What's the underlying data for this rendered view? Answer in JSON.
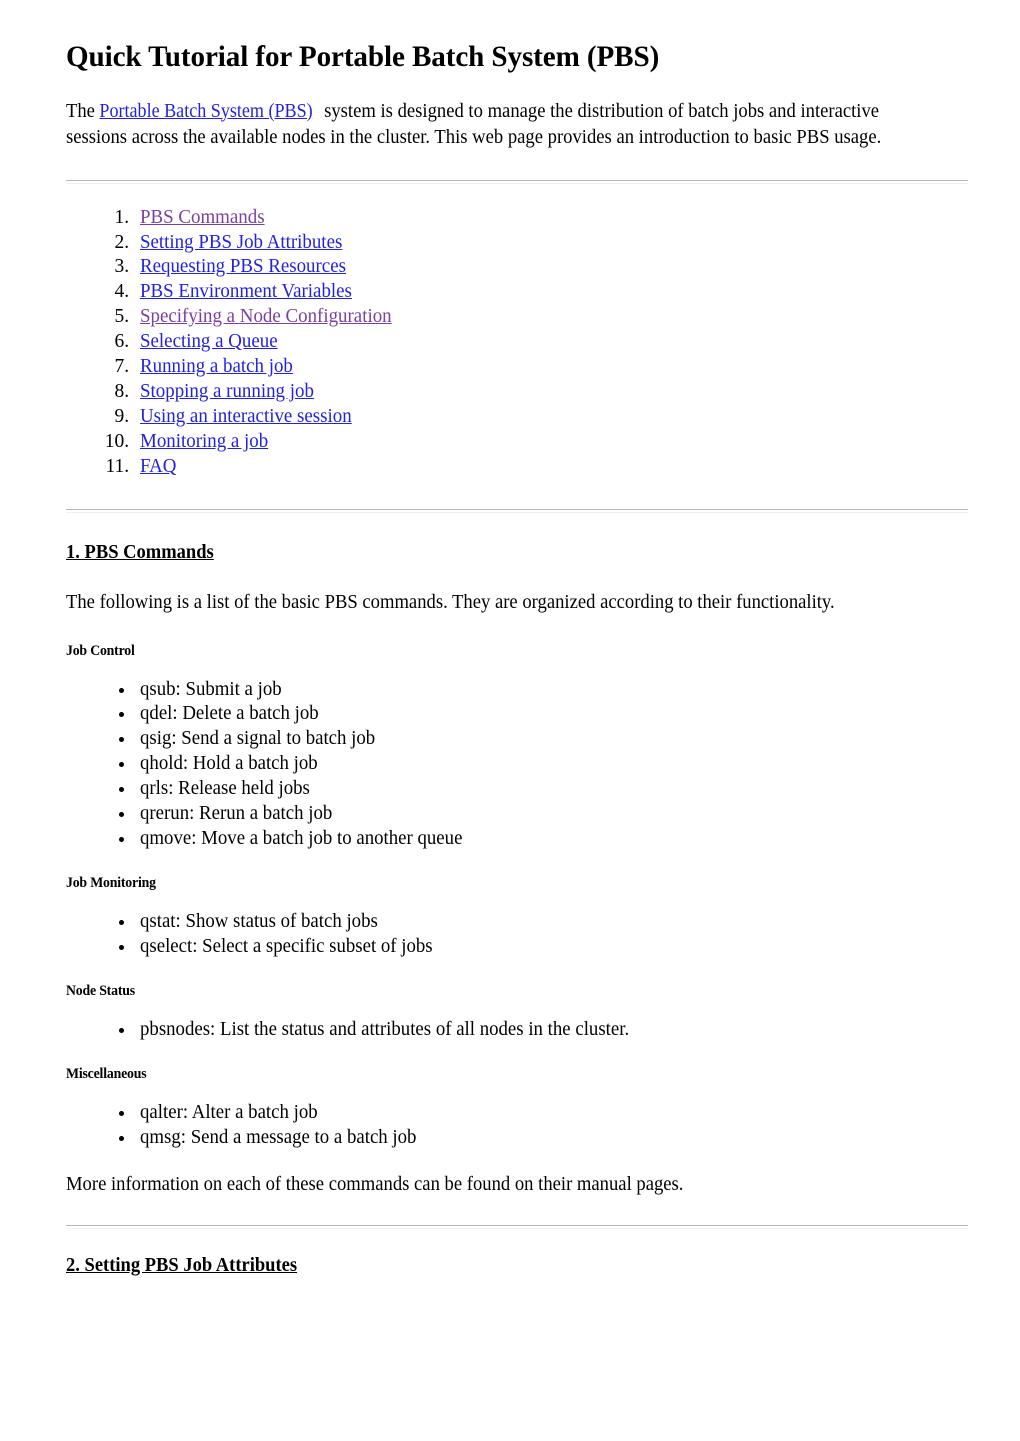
{
  "document": {
    "title": "Quick Tutorial for Portable Batch System (PBS)",
    "intro": {
      "before_link": "The ",
      "link_text": "Portable Batch System (PBS)",
      "after_link": " system is designed to manage the distribution of batch jobs and interactive sessions across the available nodes in the cluster. This web page provides an introduction to basic PBS usage."
    },
    "toc": [
      {
        "num": "1.",
        "label": "PBS Commands",
        "state": "visited"
      },
      {
        "num": "2.",
        "label": "Setting PBS Job Attributes",
        "state": "unvisited"
      },
      {
        "num": "3.",
        "label": "Requesting PBS Resources",
        "state": "unvisited"
      },
      {
        "num": "4.",
        "label": "PBS Environment Variables",
        "state": "unvisited"
      },
      {
        "num": "5.",
        "label": "Specifying a Node Configuration",
        "state": "visited"
      },
      {
        "num": "6.",
        "label": "Selecting a Queue",
        "state": "unvisited"
      },
      {
        "num": "7.",
        "label": "Running a batch job",
        "state": "unvisited"
      },
      {
        "num": "8.",
        "label": "Stopping a running job",
        "state": "unvisited"
      },
      {
        "num": "9.",
        "label": "Using an interactive session",
        "state": "unvisited"
      },
      {
        "num": "10.",
        "label": "Monitoring a job",
        "state": "unvisited"
      },
      {
        "num": "11.",
        "label": "FAQ",
        "state": "unvisited"
      }
    ],
    "section_1": {
      "heading": "1. PBS Commands",
      "intro": "The following is a list of the basic PBS commands. They are organized according to their functionality.",
      "groups": [
        {
          "subheading": "Job Control",
          "items": [
            "qsub: Submit a job",
            "qdel: Delete a batch job",
            "qsig: Send a signal to batch job",
            "qhold: Hold a batch job",
            "qrls: Release held jobs",
            "qrerun: Rerun a batch job",
            "qmove: Move a batch job to another queue"
          ]
        },
        {
          "subheading": "Job Monitoring",
          "items": [
            "qstat: Show status of batch jobs",
            "qselect: Select a specific subset of jobs"
          ]
        },
        {
          "subheading": "Node Status",
          "items": [
            "pbsnodes: List the status and attributes of all nodes in the cluster."
          ]
        },
        {
          "subheading": "Miscellaneous",
          "items": [
            "qalter: Alter a batch job",
            "qmsg: Send a message to a batch job"
          ]
        }
      ],
      "outro": "More information on each of these commands can be found on their manual pages."
    },
    "section_2": {
      "heading": "2. Setting PBS Job Attributes"
    },
    "colors": {
      "link_unvisited": "#2222dd",
      "link_visited": "#7b3f9e",
      "text": "#000000",
      "rule": "#b8b8b8",
      "background": "#ffffff"
    }
  }
}
